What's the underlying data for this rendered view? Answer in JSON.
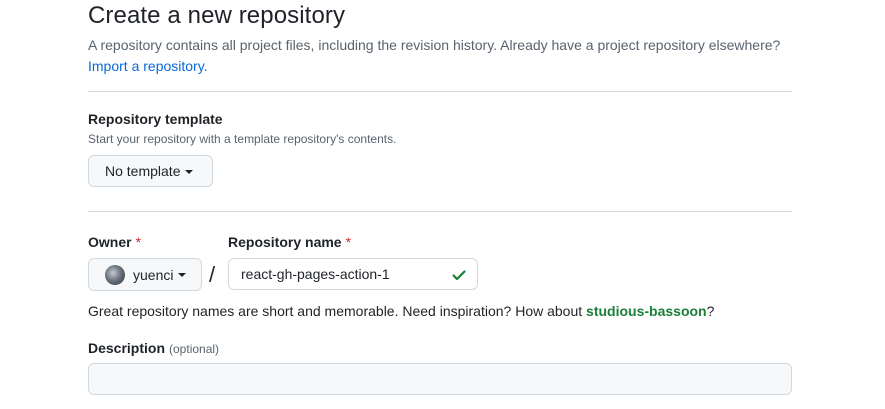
{
  "header": {
    "title": "Create a new repository",
    "subtitle": "A repository contains all project files, including the revision history. Already have a project repository elsewhere?",
    "import_link": "Import a repository."
  },
  "template": {
    "label": "Repository template",
    "note": "Start your repository with a template repository's contents.",
    "button_label": "No template"
  },
  "owner": {
    "label": "Owner",
    "required_mark": "*",
    "value": "yuenci"
  },
  "separator": "/",
  "repo_name": {
    "label": "Repository name",
    "required_mark": "*",
    "value": "react-gh-pages-action-1",
    "valid_icon": "check-icon"
  },
  "hint": {
    "text": "Great repository names are short and memorable. Need inspiration? How about ",
    "suggestion": "studious-bassoon",
    "suffix": "?"
  },
  "description": {
    "label": "Description",
    "optional": "(optional)",
    "value": "",
    "placeholder": ""
  },
  "colors": {
    "link": "#0969da",
    "suggestion": "#1a7f37",
    "required": "#d1242f",
    "check": "#1a7f37"
  }
}
